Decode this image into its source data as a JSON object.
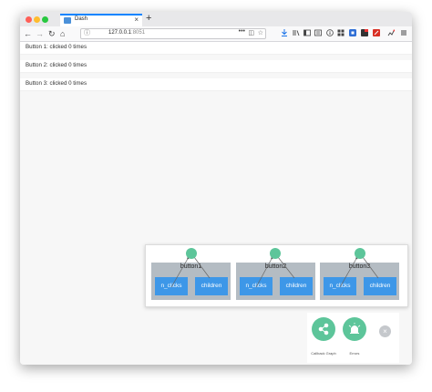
{
  "tab": {
    "title": "Dash",
    "close": "×"
  },
  "new_tab": "+",
  "url": {
    "host": "127.0.0.1",
    "port": ":8051"
  },
  "icons": {
    "back": "←",
    "forward": "→",
    "reload": "↻",
    "home": "⌂",
    "lock": "ⓘ",
    "more": "•••",
    "pocket": "◫",
    "star": "☆"
  },
  "buttons": [
    {
      "label": "Button 1: clicked 0 times"
    },
    {
      "label": "Button 2: clicked 0 times"
    },
    {
      "label": "Button 3: clicked 0 times"
    }
  ],
  "callback_graph": {
    "groups": [
      {
        "id": "button1",
        "props": [
          "n_clicks",
          "children"
        ]
      },
      {
        "id": "button2",
        "props": [
          "n_clicks",
          "children"
        ]
      },
      {
        "id": "button3",
        "props": [
          "n_clicks",
          "children"
        ]
      }
    ],
    "node_color": "#5dc59a",
    "prop_color": "#3d97e8"
  },
  "devtools": {
    "callback_graph_label": "Callback Graph",
    "errors_label": "Errors",
    "close": "×"
  }
}
